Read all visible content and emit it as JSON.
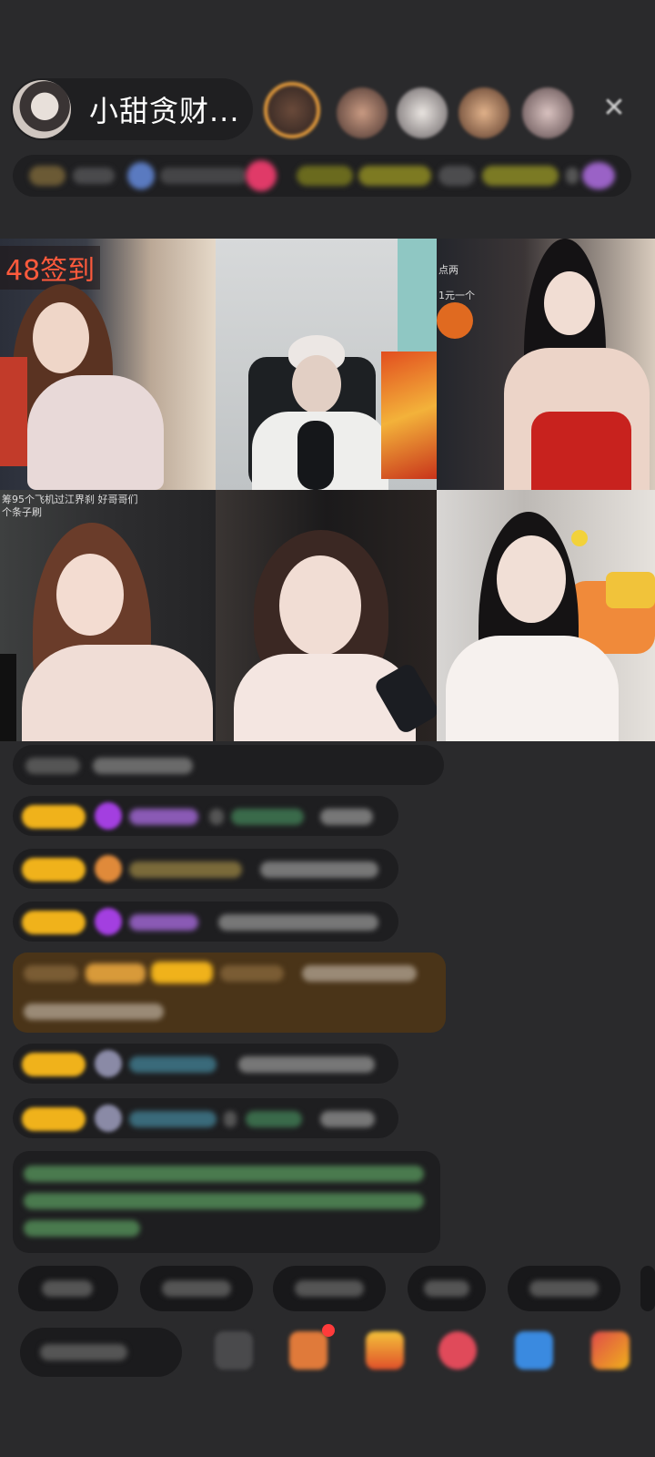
{
  "header": {
    "host_name": "小甜贪财...",
    "close_icon": "close-icon"
  },
  "grid": {
    "cell1_tag": "48签到",
    "cell2_caption": "",
    "cell3_caption_1": "点两",
    "cell3_caption_2": "1元一个",
    "cell4_caption_1": "筹95个飞机过江界刹 好哥哥们",
    "cell4_caption_2": "个条子刷"
  },
  "colors": {
    "background": "#2a2a2c",
    "panel": "#1f1f21",
    "badge_gold": "#f0b21b",
    "accent_orange": "#e39a3b",
    "highlight_brown": "#4a3418"
  }
}
